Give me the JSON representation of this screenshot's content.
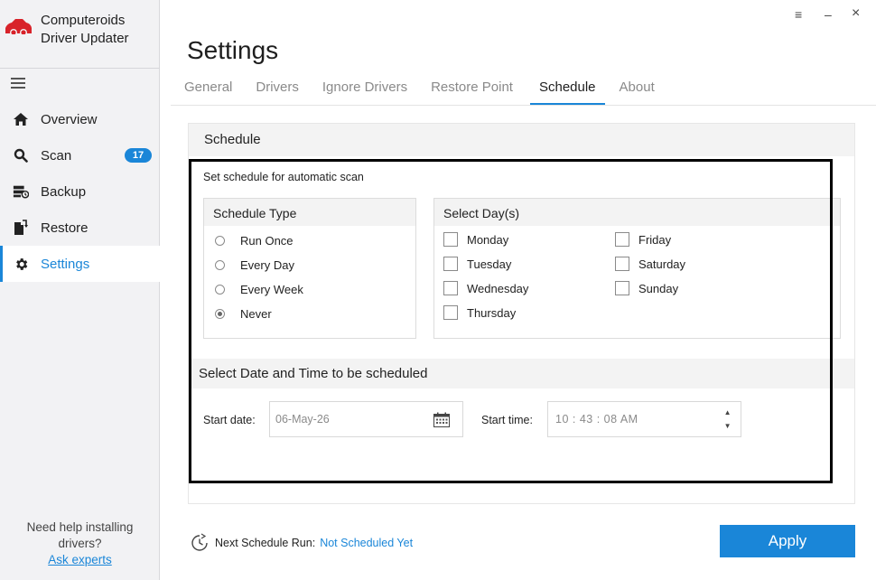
{
  "app": {
    "name_line1": "Computeroids",
    "name_line2": "Driver Updater"
  },
  "colors": {
    "accent": "#1a86d8",
    "logo": "#d8232a"
  },
  "sidebar": {
    "items": [
      {
        "label": "Overview",
        "icon": "home-icon"
      },
      {
        "label": "Scan",
        "icon": "search-icon",
        "badge": "17"
      },
      {
        "label": "Backup",
        "icon": "backup-icon"
      },
      {
        "label": "Restore",
        "icon": "restore-icon"
      },
      {
        "label": "Settings",
        "icon": "gear-icon",
        "active": true
      }
    ],
    "help_text_line1": "Need help installing",
    "help_text_line2": "drivers?",
    "help_link": "Ask experts"
  },
  "window": {
    "menu": "≡",
    "minimize": "–",
    "close": "×"
  },
  "page": {
    "title": "Settings",
    "tabs": [
      "General",
      "Drivers",
      "Ignore Drivers",
      "Restore Point",
      "Schedule",
      "About"
    ],
    "active_tab": "Schedule"
  },
  "schedule": {
    "section_title": "Schedule",
    "subtitle": "Set schedule for automatic scan",
    "type_title": "Schedule Type",
    "types": [
      "Run Once",
      "Every Day",
      "Every Week",
      "Never"
    ],
    "selected_type": "Never",
    "days_title": "Select Day(s)",
    "days_col1": [
      "Monday",
      "Tuesday",
      "Wednesday",
      "Thursday"
    ],
    "days_col2": [
      "Friday",
      "Saturday",
      "Sunday"
    ],
    "datetime_title": "Select Date and Time to be scheduled",
    "start_date_label": "Start date:",
    "start_date_value": "06-May-26",
    "start_time_label": "Start time:",
    "start_time_value": "10  :  43  :  08   AM"
  },
  "footer": {
    "next_label": "Next Schedule Run:",
    "next_value": "Not Scheduled Yet",
    "apply_label": "Apply"
  }
}
